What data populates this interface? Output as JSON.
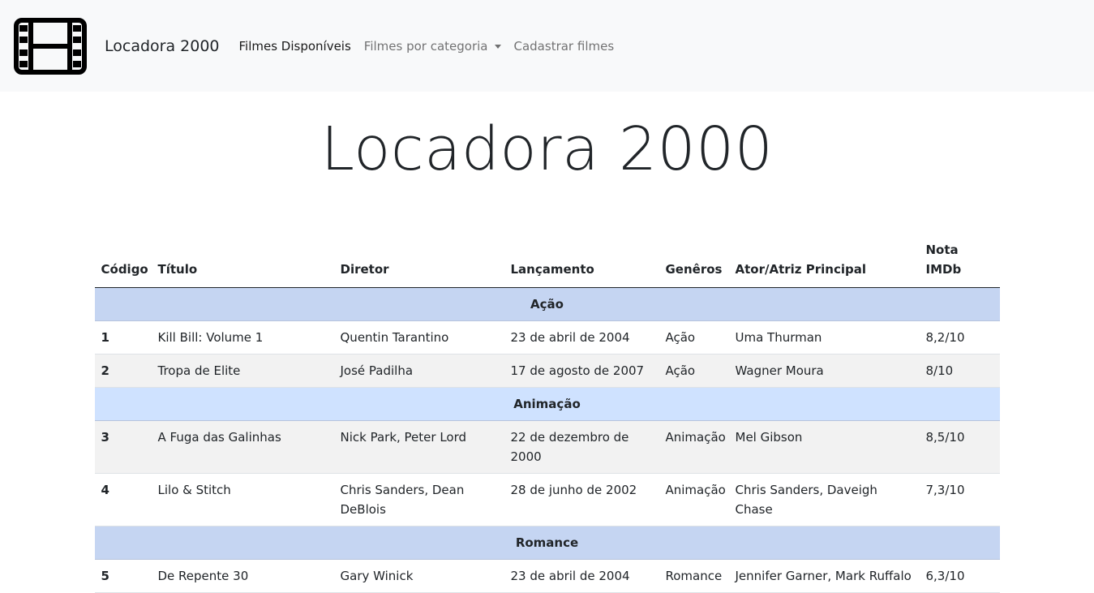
{
  "navbar": {
    "brand": "Locadora 2000",
    "links": [
      {
        "label": "Filmes Disponíveis",
        "active": true
      },
      {
        "label": "Filmes por categoria",
        "dropdown": true
      },
      {
        "label": "Cadastrar filmes"
      }
    ]
  },
  "page": {
    "title": "Locadora 2000"
  },
  "table": {
    "headers": [
      "Código",
      "Título",
      "Diretor",
      "Lançamento",
      "Genêros",
      "Ator/Atriz Principal",
      "Nota IMDb"
    ],
    "groups": [
      {
        "category": "Ação",
        "rows": [
          [
            "1",
            "Kill Bill: Volume 1",
            "Quentin Tarantino",
            "23 de abril de 2004",
            "Ação",
            "Uma Thurman",
            "8,2/10"
          ],
          [
            "2",
            "Tropa de Elite",
            "José Padilha",
            "17 de agosto de 2007",
            "Ação",
            "Wagner Moura",
            "8/10"
          ]
        ]
      },
      {
        "category": "Animação",
        "rows": [
          [
            "3",
            "A Fuga das Galinhas",
            "Nick Park, Peter Lord",
            "22 de dezembro de 2000",
            "Animação",
            "Mel Gibson",
            "8,5/10"
          ],
          [
            "4",
            "Lilo & Stitch",
            "Chris Sanders, Dean DeBlois",
            "28 de junho de 2002",
            "Animação",
            "Chris Sanders, Daveigh Chase",
            "7,3/10"
          ]
        ]
      },
      {
        "category": "Romance",
        "rows": [
          [
            "5",
            "De Repente 30",
            "Gary Winick",
            "23 de abril de 2004",
            "Romance",
            "Jennifer Garner, Mark Ruffalo",
            "6,3/10"
          ]
        ]
      }
    ]
  }
}
